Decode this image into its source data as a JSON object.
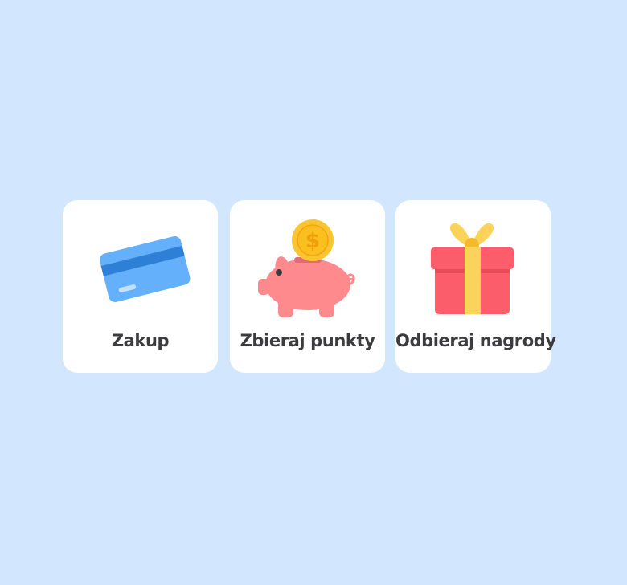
{
  "steps": [
    {
      "label": "Zakup",
      "icon": "credit-card-icon"
    },
    {
      "label": "Zbieraj punkty",
      "icon": "piggy-bank-icon"
    },
    {
      "label": "Odbieraj nagrody",
      "icon": "gift-box-icon"
    }
  ],
  "colors": {
    "background": "#d2e6fd",
    "card": "#ffffff",
    "label": "#3c3c3e",
    "card_blue": "#64b0fb",
    "card_stripe": "#2e7fd6",
    "piggy_pink": "#fe8a8e",
    "coin_gold": "#fbc531",
    "gift_red": "#fb5e6a",
    "ribbon_yellow": "#fcd35a"
  }
}
